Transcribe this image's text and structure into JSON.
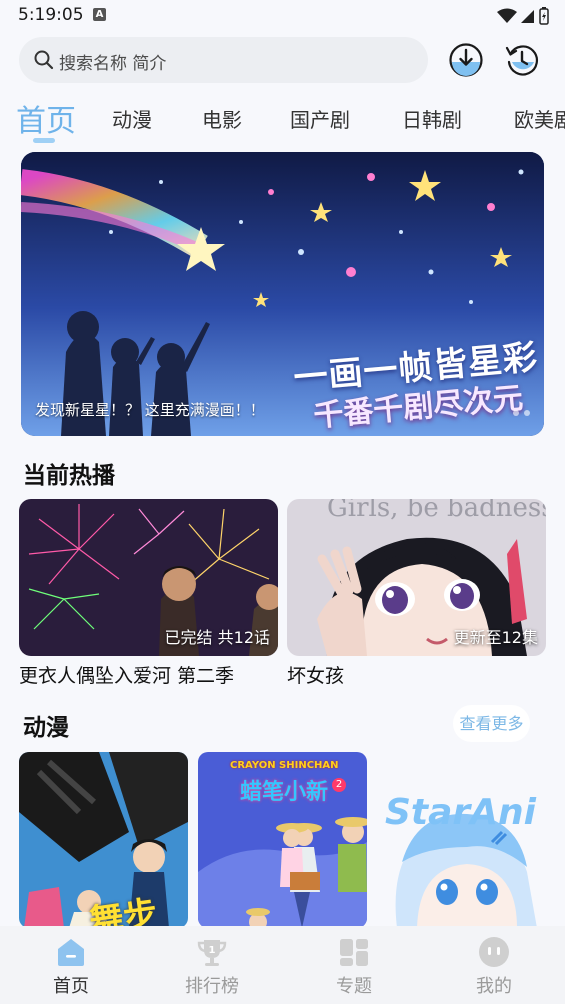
{
  "status_bar": {
    "time": "5:19:05",
    "indicator": "A"
  },
  "search": {
    "placeholder": "搜索名称 简介"
  },
  "header_icons": [
    "download-icon",
    "history-icon"
  ],
  "tabs": [
    {
      "label": "首页",
      "active": true
    },
    {
      "label": "动漫"
    },
    {
      "label": "电影"
    },
    {
      "label": "国产剧"
    },
    {
      "label": "日韩剧"
    },
    {
      "label": "欧美剧"
    }
  ],
  "banner": {
    "caption": "发现新星星！？ 这里充满漫画！！",
    "slogan_line1": "一画一帧皆星彩",
    "slogan_line2": "千番千剧尽次元"
  },
  "sections": {
    "now_playing": {
      "title": "当前热播"
    },
    "anime": {
      "title": "动漫",
      "more_label": "查看更多"
    }
  },
  "now_playing": [
    {
      "name": "更衣人偶坠入爱河 第二季",
      "badge": "已完结 共12话"
    },
    {
      "name": "坏女孩",
      "badge": "更新至12集",
      "poster_text": "Girls, be badness!"
    }
  ],
  "anime": [
    {
      "poster_text": "舞步"
    },
    {
      "poster_text_en": "CRAYON SHINCHAN",
      "poster_text_cn": "蜡笔小新",
      "poster_number": "2"
    },
    {
      "poster_text": "StarAni"
    }
  ],
  "bottom_nav": [
    {
      "label": "首页",
      "icon": "home-icon",
      "active": true
    },
    {
      "label": "排行榜",
      "icon": "trophy-icon"
    },
    {
      "label": "专题",
      "icon": "topics-icon"
    },
    {
      "label": "我的",
      "icon": "profile-icon"
    }
  ],
  "colors": {
    "accent": "#6fb3ea",
    "background": "#f7f8fc"
  }
}
